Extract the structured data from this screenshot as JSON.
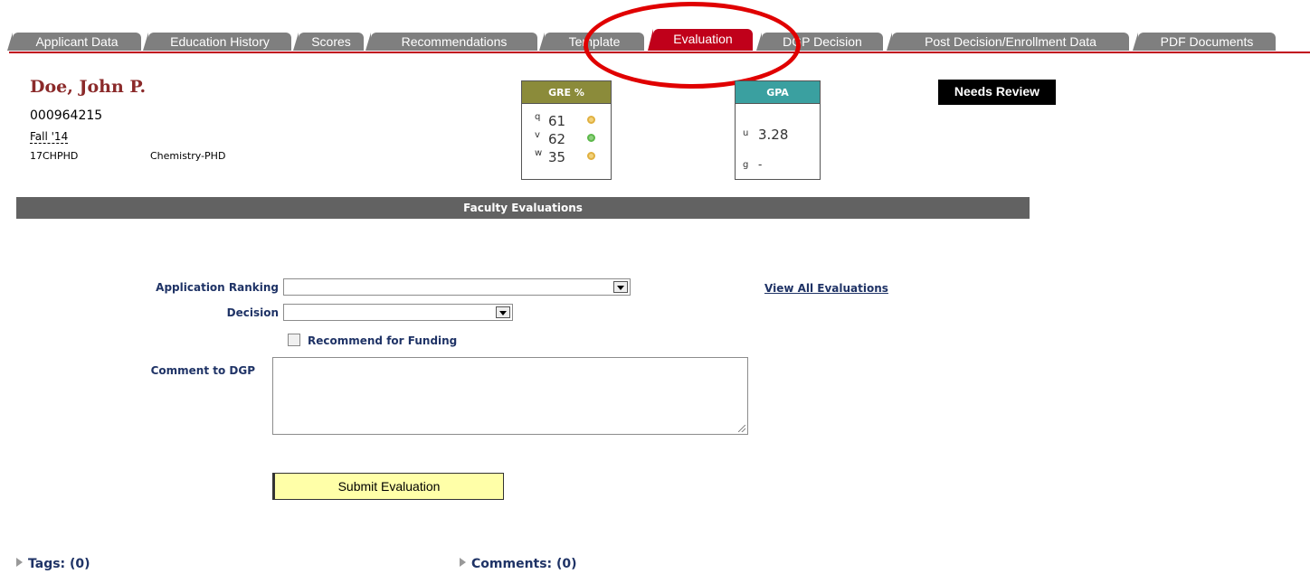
{
  "tabs": [
    {
      "label": "Applicant Data"
    },
    {
      "label": "Education History"
    },
    {
      "label": "Scores"
    },
    {
      "label": "Recommendations"
    },
    {
      "label": "Template"
    },
    {
      "label": "Evaluation"
    },
    {
      "label": "DGP Decision"
    },
    {
      "label": "Post Decision/Enrollment Data"
    },
    {
      "label": "PDF Documents"
    }
  ],
  "active_tab": "Evaluation",
  "applicant": {
    "name": "Doe, John P.",
    "id": "000964215",
    "term": "Fall '14",
    "program_code": "17CHPHD",
    "program_name": "Chemistry-PHD"
  },
  "gre": {
    "title": "GRE %",
    "q": {
      "label": "q",
      "value": "61",
      "status_color": "#e0b040"
    },
    "v": {
      "label": "v",
      "value": "62",
      "status_color": "#5cb84a"
    },
    "w": {
      "label": "w",
      "value": "35",
      "status_color": "#e0b040"
    }
  },
  "gpa": {
    "title": "GPA",
    "u": {
      "label": "u",
      "value": "3.28"
    },
    "g": {
      "label": "g",
      "value": "-"
    }
  },
  "status_badge": "Needs Review",
  "section_title": "Faculty Evaluations",
  "form": {
    "ranking_label": "Application Ranking",
    "ranking_value": "",
    "decision_label": "Decision",
    "decision_value": "",
    "funding_label": "Recommend for Funding",
    "funding_checked": false,
    "comment_label": "Comment to DGP",
    "comment_value": "",
    "view_all_link": "View All Evaluations",
    "submit_label": "Submit Evaluation"
  },
  "footer": {
    "tags": "Tags: (0)",
    "comments": "Comments: (0)"
  },
  "colors": {
    "tab_inactive": "#7f7f7f",
    "tab_active": "#c0001a",
    "gre_header": "#8b8b3a",
    "gpa_header": "#3aa0a0",
    "section_bar": "#626262",
    "name_color": "#8b2a2a",
    "annotation_oval": "#e00000"
  }
}
